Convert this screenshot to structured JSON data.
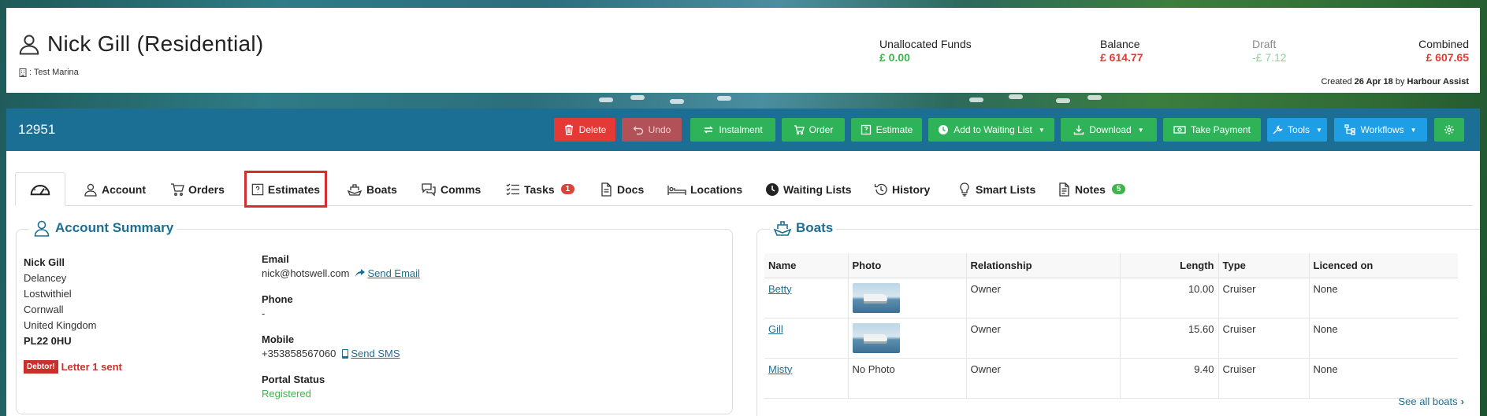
{
  "header": {
    "customer_name": "Nick Gill (Residential)",
    "marina": ": Test Marina",
    "funds": [
      {
        "label": "Unallocated Funds",
        "amount": "£ 0.00",
        "color": "#3db54a"
      },
      {
        "label": "Balance",
        "amount": "£ 614.77",
        "color": "#e53935"
      },
      {
        "label": "Draft",
        "amount": "-£ 7.12",
        "color": "#8fd19e"
      },
      {
        "label": "Combined",
        "amount": "£ 607.65",
        "color": "#e53935"
      }
    ],
    "created_prefix": "Created",
    "created_date": "26 Apr 18",
    "created_by_prefix": "by",
    "created_by": "Harbour Assist"
  },
  "toolbar": {
    "account_number": "12951",
    "buttons": [
      {
        "label": "Delete",
        "icon": "trash-icon"
      },
      {
        "label": "Undo",
        "icon": "undo-icon"
      },
      {
        "label": "Instalment",
        "icon": "exchange-icon"
      },
      {
        "label": "Order",
        "icon": "cart-icon"
      },
      {
        "label": "Estimate",
        "icon": "estimate-icon"
      },
      {
        "label": "Add to Waiting List",
        "icon": "clock-icon",
        "dropdown": true
      },
      {
        "label": "Download",
        "icon": "download-icon",
        "dropdown": true
      },
      {
        "label": "Take Payment",
        "icon": "money-icon"
      },
      {
        "label": "Tools",
        "icon": "wrench-icon",
        "dropdown": true
      },
      {
        "label": "Workflows",
        "icon": "sitemap-icon",
        "dropdown": true
      },
      {
        "label": "",
        "icon": "gear-icon"
      }
    ]
  },
  "tabs": [
    {
      "label": "",
      "icon": "dashboard-icon",
      "active": true
    },
    {
      "label": "Account",
      "icon": "user-icon"
    },
    {
      "label": "Orders",
      "icon": "cart-icon"
    },
    {
      "label": "Estimates",
      "icon": "question-square-icon",
      "highlighted": true
    },
    {
      "label": "Boats",
      "icon": "ship-icon"
    },
    {
      "label": "Comms",
      "icon": "chat-icon"
    },
    {
      "label": "Tasks",
      "icon": "task-list-icon",
      "badge": "1"
    },
    {
      "label": "Docs",
      "icon": "document-icon"
    },
    {
      "label": "Locations",
      "icon": "bed-icon"
    },
    {
      "label": "Waiting Lists",
      "icon": "clock-icon"
    },
    {
      "label": "History",
      "icon": "history-icon"
    },
    {
      "label": "Smart Lists",
      "icon": "lightbulb-icon"
    },
    {
      "label": "Notes",
      "icon": "note-icon",
      "badge": "5"
    }
  ],
  "account_summary": {
    "title": "Account Summary",
    "address": {
      "name": "Nick Gill",
      "line1": "Delancey",
      "line2": "Lostwithiel",
      "line3": "Cornwall",
      "line4": "United Kingdom",
      "postcode": "PL22 0HU"
    },
    "debtor_badge": "Debtor!",
    "debtor_text": "Letter 1 sent",
    "email_label": "Email",
    "email_value": "nick@hotswell.com",
    "send_email": " Send Email",
    "phone_label": "Phone",
    "phone_value": "-",
    "mobile_label": "Mobile",
    "mobile_value": "+353858567060",
    "send_sms": "Send SMS",
    "portal_label": "Portal Status",
    "portal_value": "Registered"
  },
  "boats": {
    "title": "Boats",
    "columns": [
      "Name",
      "Photo",
      "Relationship",
      "Length",
      "Type",
      "Licenced on"
    ],
    "rows": [
      {
        "name": "Betty",
        "photo": true,
        "relationship": "Owner",
        "length": "10.00",
        "type": "Cruiser",
        "licenced": "None"
      },
      {
        "name": "Gill",
        "photo": true,
        "relationship": "Owner",
        "length": "15.60",
        "type": "Cruiser",
        "licenced": "None"
      },
      {
        "name": "Misty",
        "photo": false,
        "photo_text": "No Photo",
        "relationship": "Owner",
        "length": "9.40",
        "type": "Cruiser",
        "licenced": "None"
      }
    ],
    "see_all": "See all boats"
  }
}
